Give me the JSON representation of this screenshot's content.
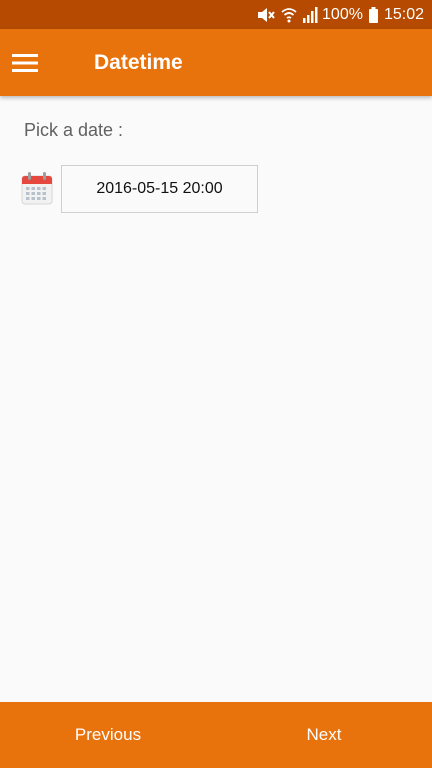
{
  "status_bar": {
    "battery": "100%",
    "time": "15:02",
    "icons": [
      "mute-icon",
      "wifi-icon",
      "signal-icon",
      "battery-icon"
    ]
  },
  "app_bar": {
    "title": "Datetime",
    "menu_icon": "hamburger-menu-icon"
  },
  "content": {
    "label": "Pick a date :",
    "calendar_icon": "calendar-icon",
    "date_value": "2016-05-15 20:00"
  },
  "bottom_nav": {
    "previous_label": "Previous",
    "next_label": "Next"
  },
  "colors": {
    "status_bar": "#b54a00",
    "primary": "#e8720c",
    "background": "#fafafa",
    "calendar_red": "#e5483f"
  }
}
